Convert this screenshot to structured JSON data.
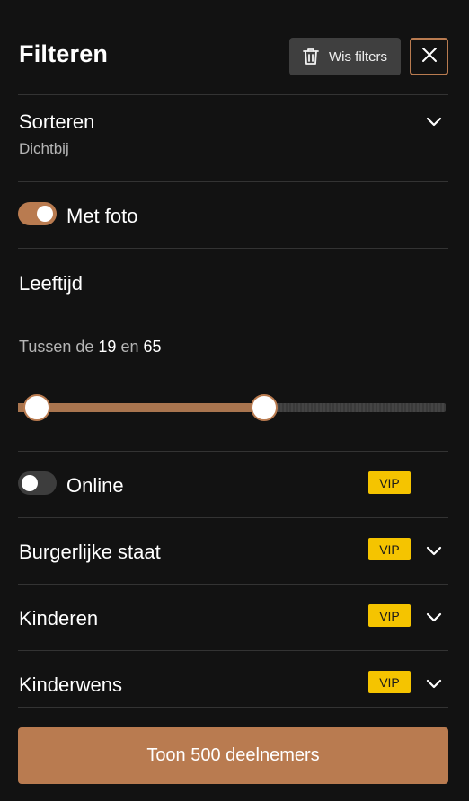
{
  "header": {
    "title": "Filteren",
    "clear_label": "Wis filters"
  },
  "sort": {
    "label": "Sorteren",
    "value": "Dichtbij"
  },
  "photo": {
    "label": "Met foto",
    "enabled": true
  },
  "age": {
    "label": "Leeftijd",
    "prefix": "Tussen de",
    "min": "19",
    "connector": "en",
    "max": "65",
    "slider_min_fraction": 0.045,
    "slider_max_fraction": 0.576
  },
  "online": {
    "label": "Online",
    "enabled": false,
    "badge": "VIP"
  },
  "civil_status": {
    "label": "Burgerlijke staat",
    "badge": "VIP"
  },
  "children": {
    "label": "Kinderen",
    "badge": "VIP"
  },
  "children_wish": {
    "label": "Kinderwens",
    "badge": "VIP"
  },
  "cta": {
    "label": "Toon 500 deelnemers"
  },
  "colors": {
    "accent": "#b97b50",
    "vip": "#f5c400",
    "background": "#121212"
  },
  "icons": {
    "clear": "trash-icon",
    "close": "close-icon",
    "expand": "chevron-down-icon"
  }
}
